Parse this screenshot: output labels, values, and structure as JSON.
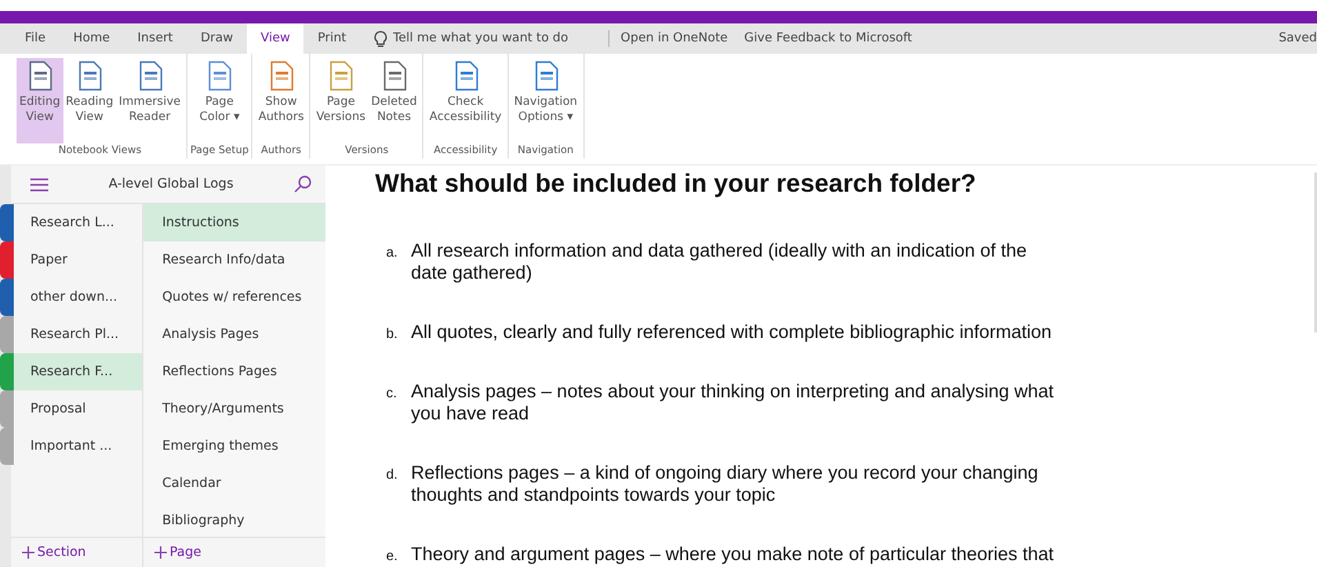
{
  "menu_tabs": [
    {
      "label": "File",
      "selected": false
    },
    {
      "label": "Home",
      "selected": false
    },
    {
      "label": "Insert",
      "selected": false
    },
    {
      "label": "Draw",
      "selected": false
    },
    {
      "label": "View",
      "selected": true
    },
    {
      "label": "Print",
      "selected": false
    }
  ],
  "tell_me": {
    "placeholder": "Tell me what you want to do"
  },
  "links": [
    "Open in OneNote",
    "Give Feedback to Microsoft"
  ],
  "status": "Saved",
  "ribbon_groups": [
    {
      "label": "Notebook Views",
      "buttons": [
        {
          "lines": [
            "Editing",
            "View"
          ],
          "selected": true
        },
        {
          "lines": [
            "Reading",
            "View"
          ],
          "selected": false
        },
        {
          "lines": [
            "Immersive",
            "Reader"
          ],
          "selected": false
        }
      ]
    },
    {
      "label": "Page Setup",
      "buttons": [
        {
          "lines": [
            "Page",
            "Color ▾"
          ],
          "selected": false
        }
      ]
    },
    {
      "label": "Authors",
      "buttons": [
        {
          "lines": [
            "Show",
            "Authors"
          ],
          "selected": false
        }
      ]
    },
    {
      "label": "Versions",
      "buttons": [
        {
          "lines": [
            "Page",
            "Versions"
          ],
          "selected": false
        },
        {
          "lines": [
            "Deleted",
            "Notes"
          ],
          "selected": false
        }
      ]
    },
    {
      "label": "Accessibility",
      "buttons": [
        {
          "lines": [
            "Check",
            "Accessibility"
          ],
          "selected": false
        }
      ]
    },
    {
      "label": "Navigation",
      "buttons": [
        {
          "lines": [
            "Navigation",
            "Options ▾"
          ],
          "selected": false
        }
      ]
    }
  ],
  "notebook": {
    "title": "A-level Global Logs"
  },
  "sections": [
    {
      "label": "Research L...",
      "color": "#1f5fae",
      "selected": false
    },
    {
      "label": "Paper",
      "color": "#e0202e",
      "selected": false
    },
    {
      "label": "other down...",
      "color": "#1f5fae",
      "selected": false
    },
    {
      "label": "Research Pl...",
      "color": "#a8a8a8",
      "selected": false
    },
    {
      "label": "Research F...",
      "color": "#22a34a",
      "selected": true
    },
    {
      "label": "Proposal",
      "color": "#a8a8a8",
      "selected": false
    },
    {
      "label": "Important ...",
      "color": "#a8a8a8",
      "selected": false
    }
  ],
  "pages": [
    {
      "label": "Instructions",
      "selected": true
    },
    {
      "label": "Research Info/data",
      "selected": false
    },
    {
      "label": "Quotes w/ references",
      "selected": false
    },
    {
      "label": "Analysis Pages",
      "selected": false
    },
    {
      "label": "Reflections Pages",
      "selected": false
    },
    {
      "label": "Theory/Arguments",
      "selected": false
    },
    {
      "label": "Emerging themes",
      "selected": false
    },
    {
      "label": "Calendar",
      "selected": false
    },
    {
      "label": "Bibliography",
      "selected": false
    }
  ],
  "add_section": "Section",
  "add_page": "Page",
  "page": {
    "title": "What should be included in your research folder?",
    "items": [
      {
        "marker": "a.",
        "text": "All research information and data gathered (ideally with an indication of the date gathered)"
      },
      {
        "marker": "b.",
        "text": "All quotes, clearly and fully referenced with complete bibliographic information"
      },
      {
        "marker": "c.",
        "text": "Analysis pages – notes about your thinking on interpreting and analysing what you have read"
      },
      {
        "marker": "d.",
        "text": "Reflections pages – a kind of ongoing diary where you record your changing thoughts and standpoints towards your topic"
      },
      {
        "marker": "e.",
        "text": "Theory and argument pages – where you make note of particular theories that"
      }
    ]
  }
}
